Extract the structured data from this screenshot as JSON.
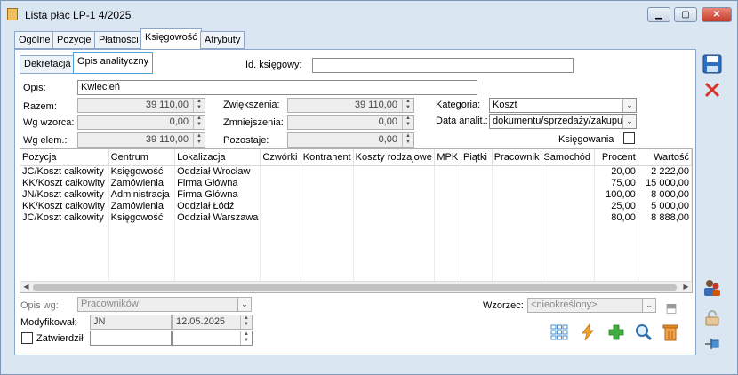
{
  "window": {
    "title": "Lista płac LP-1 4/2025"
  },
  "tabs": [
    "Ogólne",
    "Pozycje",
    "Płatności",
    "Księgowość",
    "Atrybuty"
  ],
  "subtabs": [
    "Dekretacja",
    "Opis analityczny"
  ],
  "id_ksiegowy": {
    "label": "Id. księgowy:",
    "value": ""
  },
  "opis": {
    "label": "Opis:",
    "value": "Kwiecień"
  },
  "razem": {
    "label": "Razem:",
    "value": "39 110,00"
  },
  "wg_wzorca": {
    "label": "Wg wzorca:",
    "value": "0,00"
  },
  "wg_elem": {
    "label": "Wg elem.:",
    "value": "39 110,00"
  },
  "zwiekszenia": {
    "label": "Zwiększenia:",
    "value": "39 110,00"
  },
  "zmniejszenia": {
    "label": "Zmniejszenia:",
    "value": "0,00"
  },
  "pozostaje": {
    "label": "Pozostaje:",
    "value": "0,00"
  },
  "kategoria": {
    "label": "Kategoria:",
    "value": "Koszt"
  },
  "data_analit": {
    "label": "Data analit.:",
    "value": "dokumentu/sprzedaży/zakupu"
  },
  "ksiegowania": {
    "label": "Księgowania"
  },
  "table": {
    "headers": [
      "Pozycja",
      "Centrum",
      "Lokalizacja",
      "Czwórki",
      "Kontrahent",
      "Koszty rodzajowe",
      "MPK",
      "Piątki",
      "Pracownik",
      "Samochód",
      "Procent",
      "Wartość"
    ],
    "rows": [
      [
        "JC/Koszt całkowity",
        "Księgowość",
        "Oddział Wrocław",
        "",
        "",
        "",
        "",
        "",
        "",
        "",
        "20,00",
        "2 222,00"
      ],
      [
        "KK/Koszt całkowity",
        "Zamówienia",
        "Firma Główna",
        "",
        "",
        "",
        "",
        "",
        "",
        "",
        "75,00",
        "15 000,00"
      ],
      [
        "JN/Koszt całkowity",
        "Administracja",
        "Firma Główna",
        "",
        "",
        "",
        "",
        "",
        "",
        "",
        "100,00",
        "8 000,00"
      ],
      [
        "KK/Koszt całkowity",
        "Zamówienia",
        "Oddział Łódź",
        "",
        "",
        "",
        "",
        "",
        "",
        "",
        "25,00",
        "5 000,00"
      ],
      [
        "JC/Koszt całkowity",
        "Księgowość",
        "Oddział Warszawa",
        "",
        "",
        "",
        "",
        "",
        "",
        "",
        "80,00",
        "8 888,00"
      ]
    ]
  },
  "opis_wg": {
    "label": "Opis wg:",
    "value": "Pracowników"
  },
  "wzorzec": {
    "label": "Wzorzec:",
    "value": "<nieokreślony>"
  },
  "modyfikowal": {
    "label": "Modyfikował:",
    "user": "JN",
    "date": "12.05.2025"
  },
  "zatwierdzil": {
    "label": "Zatwierdził",
    "user": "",
    "date": ""
  },
  "icons": [
    "grid-icon",
    "lightning-icon",
    "add-icon",
    "search-icon",
    "trash-icon",
    "save-icon",
    "cancel-icon",
    "people-icon",
    "lock-icon",
    "pin-icon"
  ]
}
